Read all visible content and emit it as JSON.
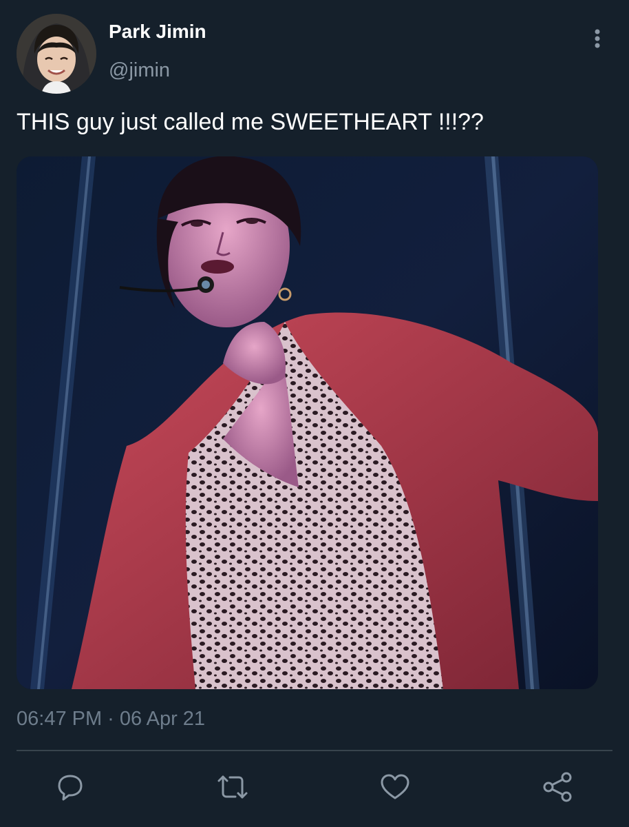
{
  "tweet": {
    "author": {
      "display_name": "Park Jimin",
      "handle": "@jimin"
    },
    "text": "THIS guy just called me SWEETHEART !!!??",
    "timestamp": "06:47 PM · 06 Apr 21"
  },
  "icons": {
    "more": "more-vertical-icon",
    "reply": "reply-icon",
    "retweet": "retweet-icon",
    "like": "heart-icon",
    "share": "share-icon"
  },
  "colors": {
    "background": "#15202b",
    "text_primary": "#ffffff",
    "text_secondary": "#8b98a5",
    "divider": "#38444d",
    "icon": "#8b98a5"
  }
}
